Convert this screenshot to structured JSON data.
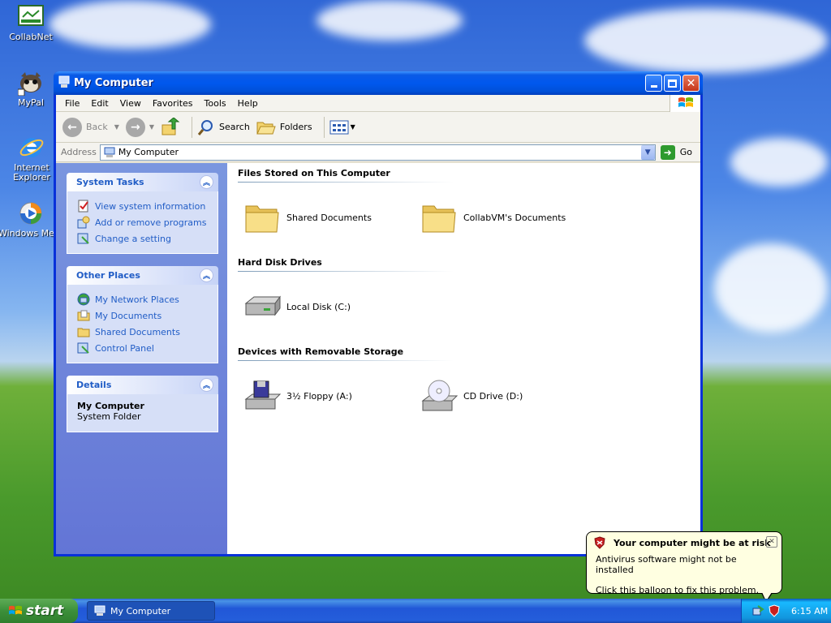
{
  "desktop": {
    "icons": [
      {
        "label": "CollabNet"
      },
      {
        "label": "MyPal"
      },
      {
        "label": "Internet Explorer"
      },
      {
        "label": "Windows Media Player"
      }
    ]
  },
  "window": {
    "title": "My Computer",
    "menu": [
      "File",
      "Edit",
      "View",
      "Favorites",
      "Tools",
      "Help"
    ],
    "toolbar": {
      "back": "Back",
      "search": "Search",
      "folders": "Folders"
    },
    "address": {
      "label": "Address",
      "value": "My Computer",
      "go": "Go"
    },
    "left_panels": {
      "system_tasks": {
        "title": "System Tasks",
        "items": [
          "View system information",
          "Add or remove programs",
          "Change a setting"
        ]
      },
      "other_places": {
        "title": "Other Places",
        "items": [
          "My Network Places",
          "My Documents",
          "Shared Documents",
          "Control Panel"
        ]
      },
      "details": {
        "title": "Details",
        "name": "My Computer",
        "type": "System Folder"
      }
    },
    "groups": [
      {
        "title": "Files Stored on This Computer",
        "items": [
          "Shared Documents",
          "CollabVM's Documents"
        ]
      },
      {
        "title": "Hard Disk Drives",
        "items": [
          "Local Disk (C:)"
        ]
      },
      {
        "title": "Devices with Removable Storage",
        "items": [
          "3½ Floppy (A:)",
          "CD Drive (D:)"
        ]
      }
    ]
  },
  "balloon": {
    "title": "Your computer might be at risk",
    "line1": "Antivirus software might not be installed",
    "line2": "Click this balloon to fix this problem."
  },
  "taskbar": {
    "start": "start",
    "task": "My Computer",
    "clock": "6:15 AM"
  }
}
